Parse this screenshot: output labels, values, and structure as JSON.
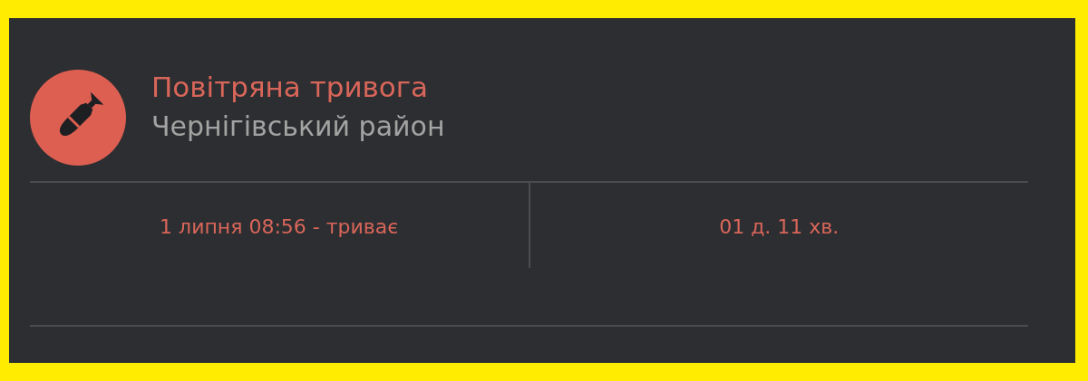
{
  "alert": {
    "title": "Повітряна тривога",
    "region": "Чернігівський район",
    "period": "1 липня 08:56 - триває",
    "duration": "01 д. 11 хв."
  }
}
